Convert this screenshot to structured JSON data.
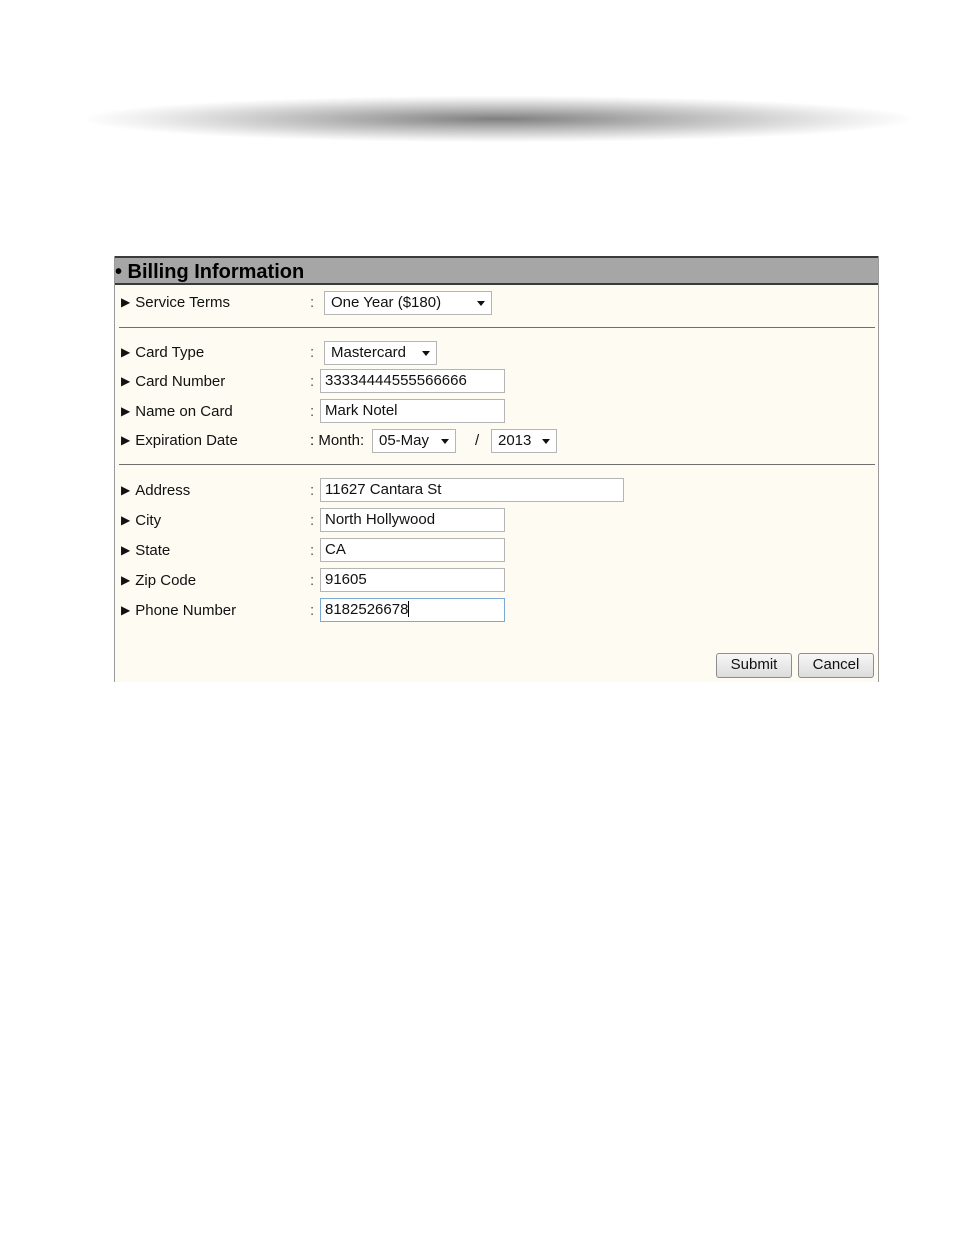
{
  "form": {
    "title": "• Billing Information",
    "service_terms": {
      "label": "Service Terms",
      "value": "One Year ($180)"
    },
    "card_type": {
      "label": "Card Type",
      "value": "Mastercard"
    },
    "card_number": {
      "label": "Card Number",
      "value": "33334444555566666"
    },
    "name_on_card": {
      "label": "Name on Card",
      "value": "Mark Notel"
    },
    "expiration": {
      "label": "Expiration Date",
      "month_prefix": ": Month:",
      "month_value": "05-May",
      "separator": "/",
      "year_value": "2013"
    },
    "address": {
      "label": "Address",
      "value": "11627 Cantara St"
    },
    "city": {
      "label": "City",
      "value": "North Hollywood"
    },
    "state": {
      "label": "State",
      "value": "CA"
    },
    "zip": {
      "label": "Zip Code",
      "value": "91605"
    },
    "phone": {
      "label": "Phone Number",
      "value": "8182526678"
    },
    "colon": ":",
    "submit_label": "Submit",
    "cancel_label": "Cancel"
  },
  "icons": {
    "row_bullet": "triangle-right-icon",
    "dropdown": "chevron-down-icon"
  },
  "colors": {
    "header_bg": "#a6a6a6",
    "panel_bg": "#fdfbf2",
    "focus_border": "#7aa9d6"
  }
}
